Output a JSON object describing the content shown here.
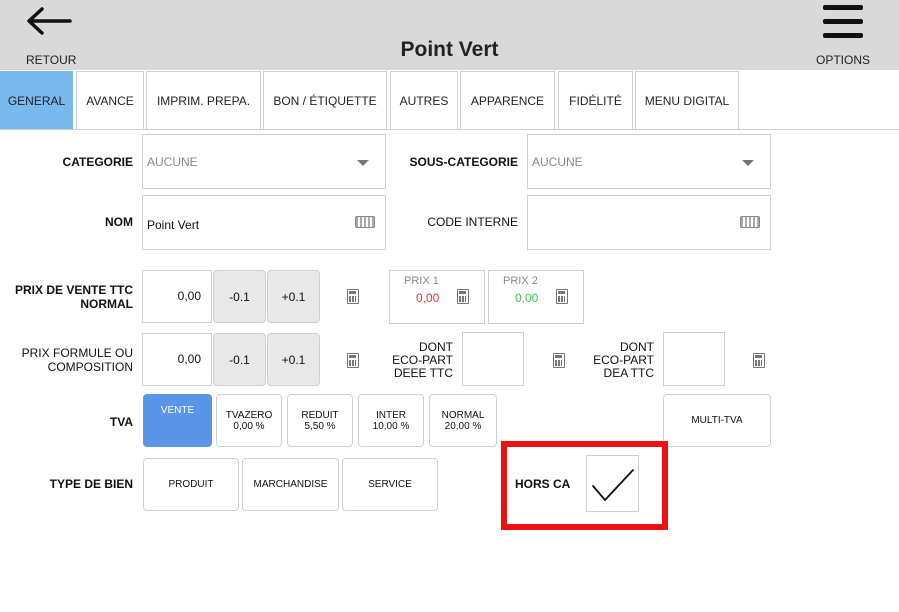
{
  "header": {
    "back_label": "RETOUR",
    "title": "Point Vert",
    "options_label": "OPTIONS"
  },
  "tabs": [
    {
      "label": "GENERAL",
      "active": true
    },
    {
      "label": "AVANCE"
    },
    {
      "label": "IMPRIM. PREPA."
    },
    {
      "label": "BON / ÉTIQUETTE"
    },
    {
      "label": "AUTRES"
    },
    {
      "label": "APPARENCE"
    },
    {
      "label": "FIDÉLITÉ"
    },
    {
      "label": "MENU DIGITAL"
    }
  ],
  "form": {
    "categorie_label": "CATEGORIE",
    "categorie_value": "AUCUNE",
    "souscategorie_label": "SOUS-CATEGORIE",
    "souscategorie_value": "AUCUNE",
    "nom_label": "NOM",
    "nom_value": "Point Vert",
    "code_interne_label": "CODE INTERNE",
    "code_interne_value": "",
    "prix_vente_label_1": "PRIX DE VENTE TTC",
    "prix_vente_label_2": "NORMAL",
    "prix_vente_value": "0,00",
    "minus_label": "-0.1",
    "plus_label": "+0.1",
    "prix1_title": "PRIX 1",
    "prix1_value": "0,00",
    "prix2_title": "PRIX 2",
    "prix2_value": "0,00",
    "prix_formule_label_1": "PRIX FORMULE OU",
    "prix_formule_label_2": "COMPOSITION",
    "prix_formule_value": "0,00",
    "deee_label_1": "DONT",
    "deee_label_2": "ECO-PART",
    "deee_label_3": "DEEE TTC",
    "deee_value": "",
    "dea_label_1": "DONT",
    "dea_label_2": "ECO-PART",
    "dea_label_3": "DEA TTC",
    "dea_value": "",
    "tva_label": "TVA",
    "tva_buttons": [
      {
        "line1": "VENTE",
        "line2": "",
        "active": true
      },
      {
        "line1": "TVAZERO",
        "line2": "0,00 %"
      },
      {
        "line1": "REDUIT",
        "line2": "5,50 %"
      },
      {
        "line1": "INTER",
        "line2": "10,00 %"
      },
      {
        "line1": "NORMAL",
        "line2": "20,00 %"
      }
    ],
    "multi_tva_label": "MULTI-TVA",
    "type_bien_label": "TYPE DE BIEN",
    "type_bien_buttons": [
      "PRODUIT",
      "MARCHANDISE",
      "SERVICE"
    ],
    "hors_ca_label": "HORS CA",
    "hors_ca_checked": true
  },
  "colors": {
    "active_tab": "#79b9ee",
    "active_button": "#5b95e8",
    "prix1": "#e53935",
    "prix2": "#43c65a",
    "highlight": "#ee1111"
  }
}
